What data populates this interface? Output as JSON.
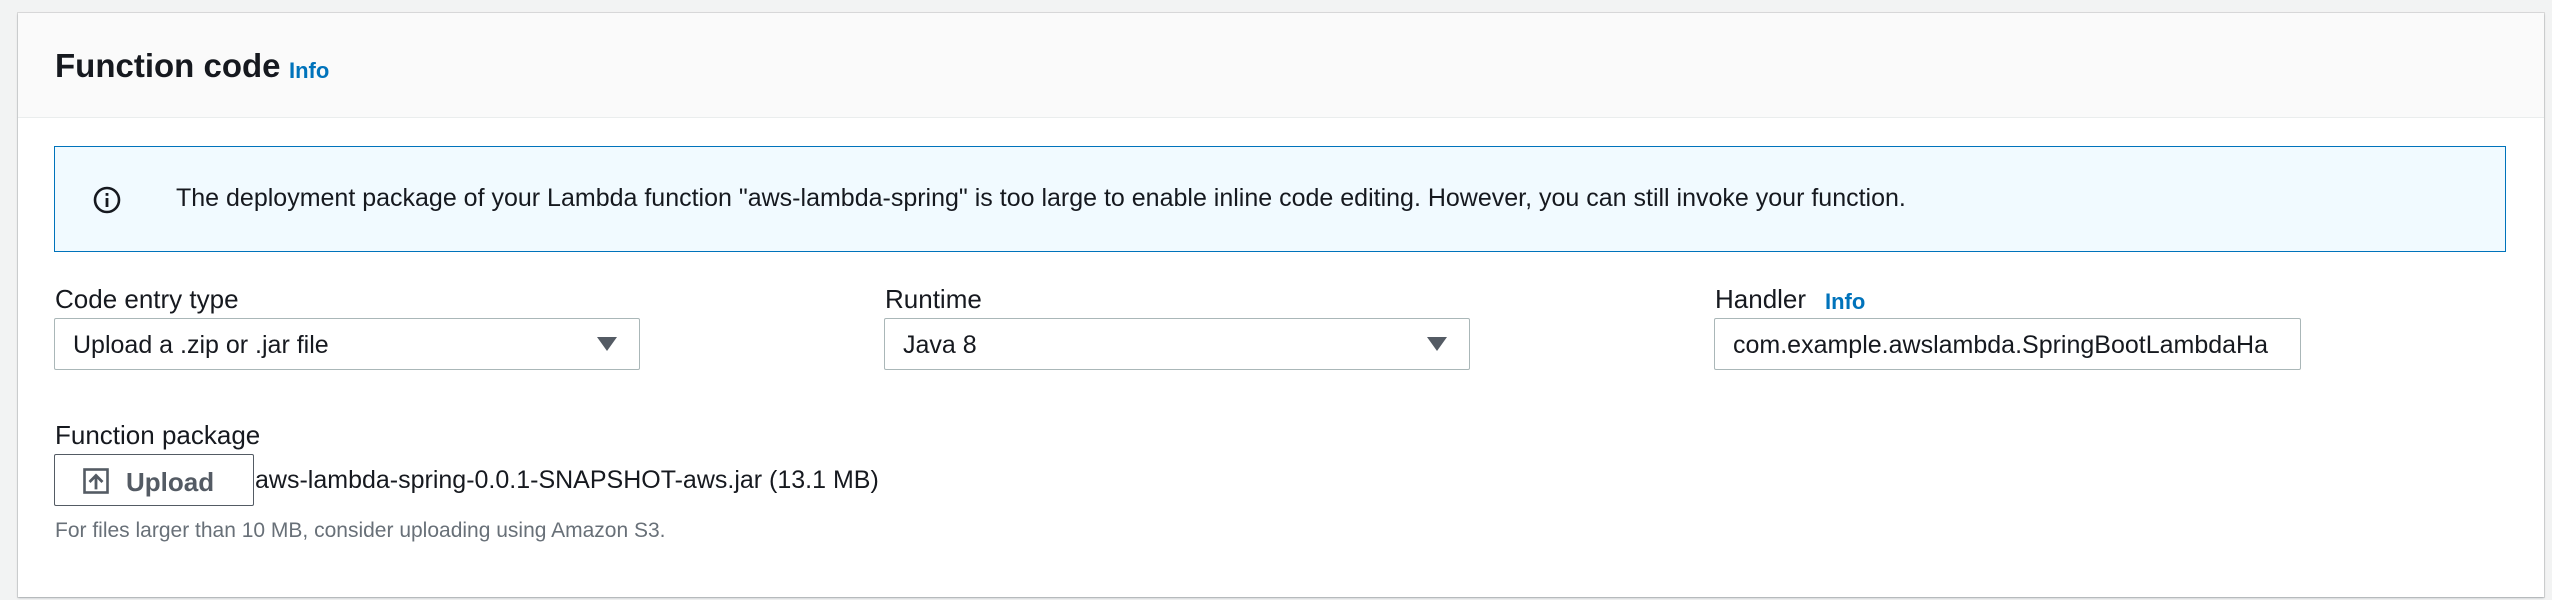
{
  "section": {
    "title": "Function code",
    "info_label": "Info"
  },
  "alert": {
    "icon": "info-circle-icon",
    "message": "The deployment package of your Lambda function \"aws-lambda-spring\" is too large to enable inline code editing. However, you can still invoke your function."
  },
  "code_entry": {
    "label": "Code entry type",
    "selected": "Upload a .zip or .jar file"
  },
  "runtime": {
    "label": "Runtime",
    "selected": "Java 8"
  },
  "handler": {
    "label": "Handler",
    "info_label": "Info",
    "value": "com.example.awslambda.SpringBootLambdaHa"
  },
  "function_package": {
    "label": "Function package",
    "upload_label": "Upload",
    "upload_icon": "upload-icon",
    "file_name": "aws-lambda-spring-0.0.1-SNAPSHOT-aws.jar (13.1 MB)",
    "hint": "For files larger than 10 MB, consider uploading using Amazon S3."
  },
  "colors": {
    "link": "#0073bb",
    "alert_background": "#f1faff",
    "alert_border": "#0073bb",
    "hint_text": "#687078"
  }
}
